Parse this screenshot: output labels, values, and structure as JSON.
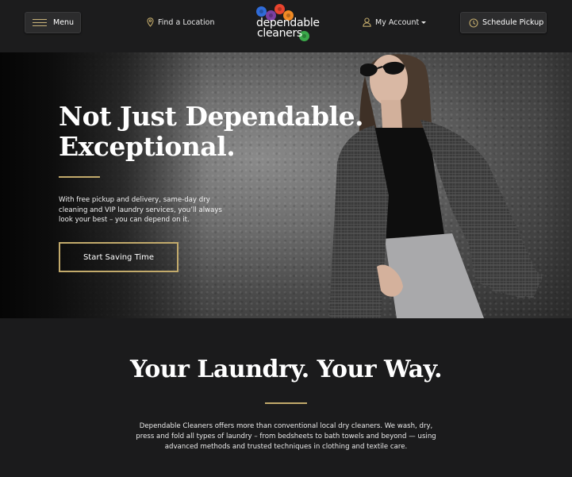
{
  "header": {
    "menu_label": "Menu",
    "find_location_label": "Find a Location",
    "logo": {
      "line1": "dependable",
      "line2": "cleaners"
    },
    "my_account_label": "My Account",
    "schedule_pickup_label": "Schedule Pickup"
  },
  "hero": {
    "title_line1": "Not Just Dependable.",
    "title_line2": "Exceptional.",
    "body": "With free pickup and delivery, same-day dry cleaning and VIP laundry services, you’ll always look your best – you can depend on it.",
    "cta_label": "Start Saving Time"
  },
  "section2": {
    "title": "Your Laundry. Your Way.",
    "body": "Dependable Cleaners offers more than conventional local dry cleaners. We wash, dry, press and fold all types of laundry – from bedsheets to bath towels and beyond — using advanced methods and trusted techniques in clothing and textile care."
  },
  "colors": {
    "accent_gold": "#c2aa6b",
    "background": "#1b1b1c",
    "logo_dots": [
      "#e8442e",
      "#2f6bd8",
      "#7a3fa0",
      "#f08a24",
      "#3aa84a"
    ]
  },
  "icons": {
    "menu": "hamburger-icon",
    "location": "map-pin-icon",
    "account": "user-icon",
    "schedule": "clock-icon"
  }
}
